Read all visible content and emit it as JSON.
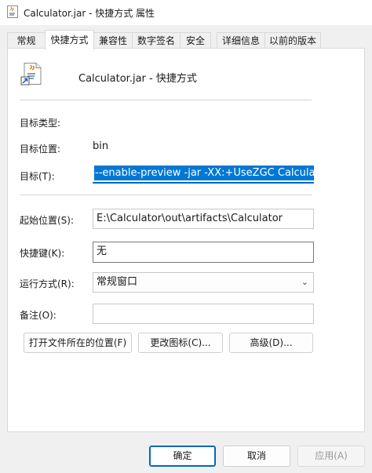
{
  "window": {
    "title": "Calculator.jar - 快捷方式 属性"
  },
  "tabs": [
    {
      "label": "常规",
      "active": false
    },
    {
      "label": "快捷方式",
      "active": true
    },
    {
      "label": "兼容性",
      "active": false
    },
    {
      "label": "数字签名",
      "active": false
    },
    {
      "label": "安全",
      "active": false
    },
    {
      "label": "详细信息",
      "active": false
    },
    {
      "label": "以前的版本",
      "active": false
    }
  ],
  "shortcut": {
    "file_name": "Calculator.jar - 快捷方式",
    "target_type_label": "目标类型:",
    "target_type_value": "",
    "target_location_label": "目标位置:",
    "target_location_value": "bin",
    "target_label": "目标(T):",
    "target_value": "--enable-preview -jar -XX:+UseZGC Calculator.jar",
    "start_in_label": "起始位置(S):",
    "start_in_value": "E:\\Calculator\\out\\artifacts\\Calculator",
    "hotkey_label": "快捷键(K):",
    "hotkey_value": "无",
    "run_label": "运行方式(R):",
    "run_value": "常规窗口",
    "comment_label": "备注(O):",
    "comment_value": "",
    "open_location_button": "打开文件所在的位置(F)",
    "change_icon_button": "更改图标(C)...",
    "advanced_button": "高级(D)..."
  },
  "footer": {
    "ok": "确定",
    "cancel": "取消",
    "apply": "应用(A)"
  },
  "icons": [
    "java-app-icon",
    "java-shortcut-icon",
    "shortcut-arrow-icon",
    "chevron-down-icon"
  ],
  "colors": {
    "accent": "#0078d4",
    "selection": "#0078d4",
    "focus_underline": "#0067c0"
  }
}
